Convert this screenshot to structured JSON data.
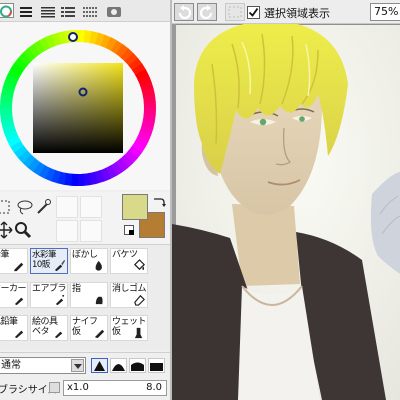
{
  "left_tabs": [
    {
      "icon": "color-wheel-icon",
      "active": true
    },
    {
      "icon": "rgb-sliders-icon",
      "active": false
    },
    {
      "icon": "hsv-sliders-icon",
      "active": false
    },
    {
      "icon": "color-swatches-icon",
      "active": false
    },
    {
      "icon": "user-color-icon",
      "active": false
    },
    {
      "icon": "scratchpad-icon",
      "active": false
    }
  ],
  "colors": {
    "main": "#d9d98a",
    "sub": "#b57c33",
    "hue_marker": "#f2e31a",
    "accent": "#3c63c2"
  },
  "tools": [
    "selection-tool-icon",
    "lasso-tool-icon",
    "magic-wand-icon",
    "move-tool-icon",
    "zoom-tool-icon"
  ],
  "brushes": [
    {
      "label": "鉛筆",
      "icon": "pencil-icon",
      "selected": false
    },
    {
      "label": "水彩筆\n10販",
      "icon": "watercolor-brush-icon",
      "selected": true
    },
    {
      "label": "ぼかし",
      "icon": "blur-icon",
      "selected": false
    },
    {
      "label": "バケツ",
      "icon": "bucket-icon",
      "selected": false
    },
    {
      "label": "マーカー",
      "icon": "marker-icon",
      "selected": false
    },
    {
      "label": "エアブラシ",
      "icon": "airbrush-icon",
      "selected": false
    },
    {
      "label": "指",
      "icon": "finger-icon",
      "selected": false
    },
    {
      "label": "消しゴム",
      "icon": "eraser-icon",
      "selected": false
    },
    {
      "label": "色鉛筆",
      "icon": "color-pencil-icon",
      "selected": false
    },
    {
      "label": "絵の具\nベタ",
      "icon": "paint-icon",
      "selected": false
    },
    {
      "label": "ナイフ\n仮",
      "icon": "knife-icon",
      "selected": false
    },
    {
      "label": "ウェット\n仮",
      "icon": "wet-brush-icon",
      "selected": false
    }
  ],
  "blend_mode": "通常",
  "brush_shapes": [
    "shape-hard-icon",
    "shape-soft-icon",
    "shape-round-icon",
    "shape-flat-icon"
  ],
  "brush_size": {
    "label": "ブラシサイズ",
    "multiplier": "x1.0",
    "value": "8.0"
  },
  "toolbar": {
    "buttons": [
      "undo-icon",
      "redo-icon",
      "deselect-icon",
      "invert-selection-icon"
    ],
    "show_selection_label": "選択領域表示",
    "show_selection_checked": true,
    "zoom": "75%"
  }
}
